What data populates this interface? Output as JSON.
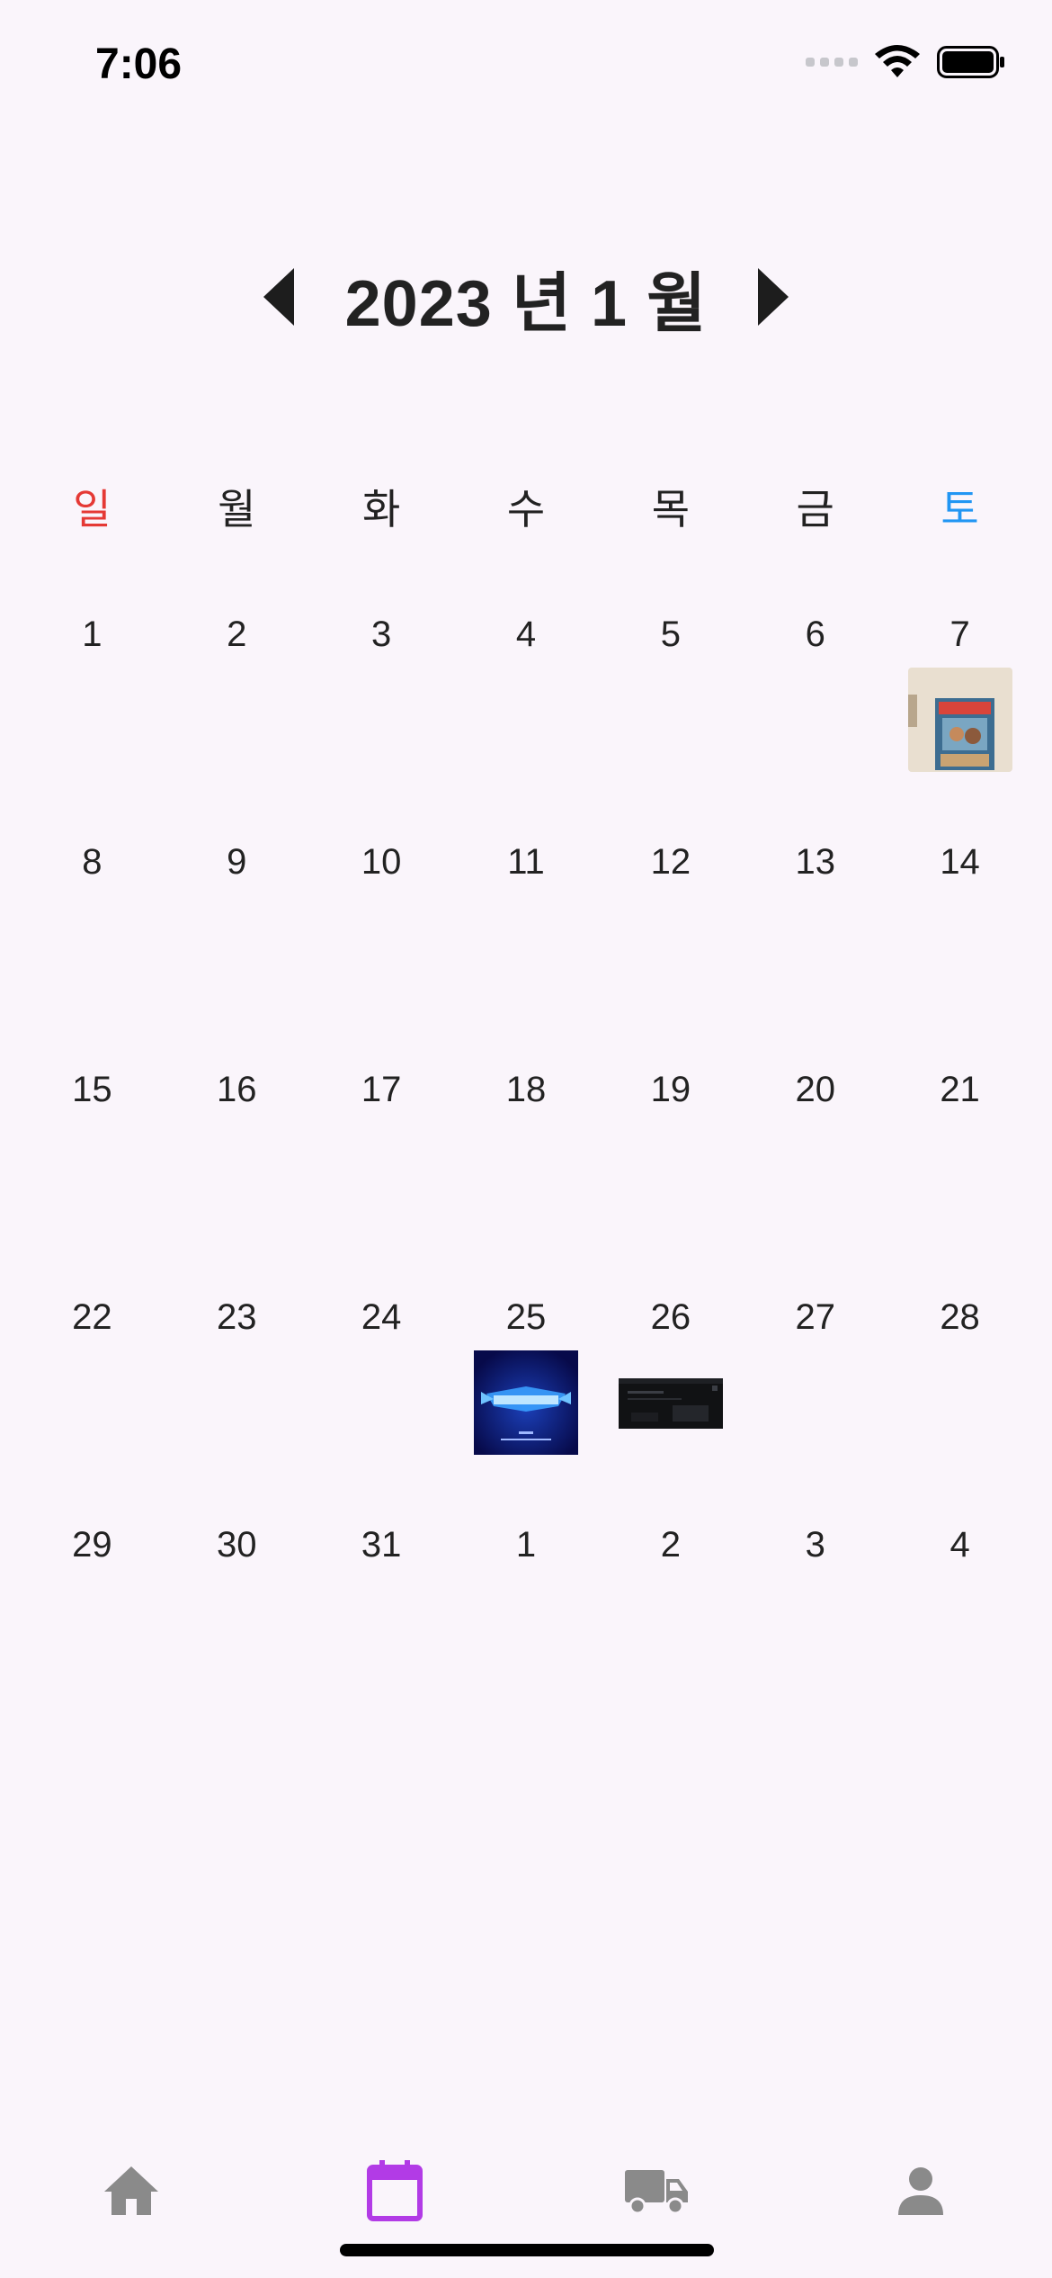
{
  "status_bar": {
    "time": "7:06"
  },
  "header": {
    "month_title": "2023 년 1 월",
    "prev_icon": "caret-left-icon",
    "next_icon": "caret-right-icon"
  },
  "weekdays": [
    "일",
    "월",
    "화",
    "수",
    "목",
    "금",
    "토"
  ],
  "colors": {
    "sunday": "#e53935",
    "saturday": "#2196f3",
    "active_nav": "#b23be6",
    "inactive_nav": "#8a8a8a",
    "background": "#faf5fb"
  },
  "days": [
    "1",
    "2",
    "3",
    "4",
    "5",
    "6",
    "7",
    "8",
    "9",
    "10",
    "11",
    "12",
    "13",
    "14",
    "15",
    "16",
    "17",
    "18",
    "19",
    "20",
    "21",
    "22",
    "23",
    "24",
    "25",
    "26",
    "27",
    "28",
    "29",
    "30",
    "31",
    "1",
    "2",
    "3",
    "4"
  ],
  "day_thumbnails": {
    "7": "movie-poster-thumbnail",
    "25": "blue-logo-thumbnail",
    "26": "dark-screenshot-thumbnail"
  },
  "bottom_nav": [
    {
      "icon": "home-icon",
      "active": false
    },
    {
      "icon": "calendar-icon",
      "active": true
    },
    {
      "icon": "truck-icon",
      "active": false
    },
    {
      "icon": "person-icon",
      "active": false
    }
  ]
}
